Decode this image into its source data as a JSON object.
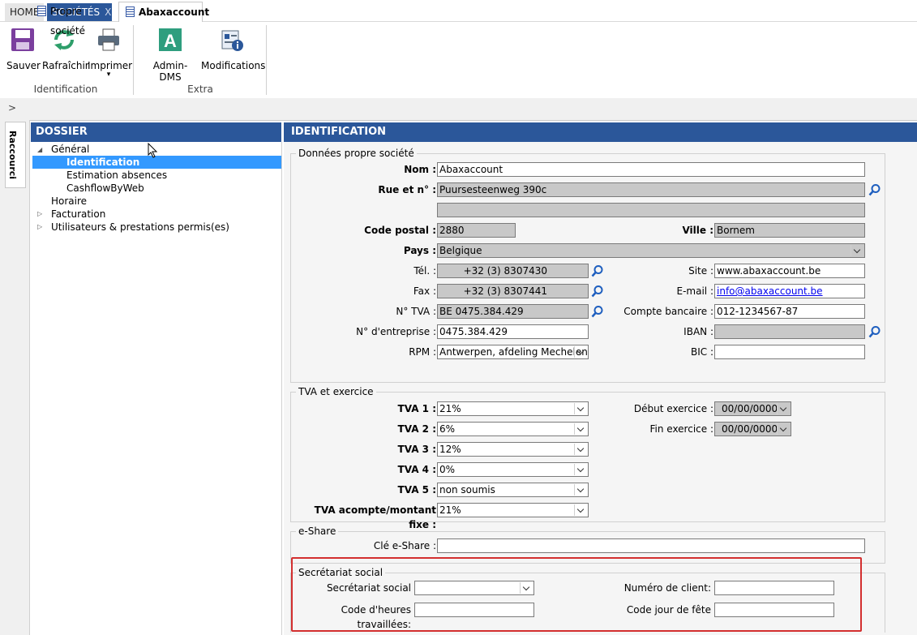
{
  "top_tabs": {
    "home": "HOME",
    "societes": "SOCIÉTÉS",
    "close": "X"
  },
  "ribbon": {
    "save": "Sauver",
    "refresh": "Rafraîchir",
    "print": "Imprimer",
    "print_arrow": "▾",
    "group_identification": "Identification",
    "admin_dms": "Admin-DMS",
    "modifications": "Modifications",
    "group_extra": "Extra"
  },
  "doc_tabs": {
    "chevron": ">",
    "propre": "Propre société",
    "abax": "Abaxaccount"
  },
  "side_tab": "Raccourci",
  "dossier": {
    "title": "DOSSIER",
    "items": [
      {
        "label": "Général",
        "arrow": "◢"
      },
      {
        "label": "Identification"
      },
      {
        "label": "Estimation absences"
      },
      {
        "label": "CashflowByWeb"
      },
      {
        "label": "Horaire"
      },
      {
        "label": "Facturation",
        "arrow": "▷"
      },
      {
        "label": "Utilisateurs & prestations permis(es)",
        "arrow": "▷"
      }
    ]
  },
  "identification": {
    "title": "IDENTIFICATION",
    "company": {
      "legend": "Données propre société",
      "nom_label": "Nom :",
      "nom": "Abaxaccount",
      "rue_label": "Rue et n° :",
      "rue": "Puursesteenweg 390c",
      "rue2": "",
      "cp_label": "Code postal :",
      "cp": "2880",
      "ville_label": "Ville :",
      "ville": "Bornem",
      "pays_label": "Pays :",
      "pays": "Belgique",
      "tel_label": "Tél. :",
      "tel": "+32 (3) 8307430",
      "fax_label": "Fax :",
      "fax": "+32 (3) 8307441",
      "tva_label": "N° TVA :",
      "tva": "BE 0475.384.429",
      "entreprise_label": "N° d'entreprise :",
      "entreprise": "0475.384.429",
      "rpm_label": "RPM :",
      "rpm": "Antwerpen, afdeling Mechelen",
      "site_label": "Site :",
      "site": "www.abaxaccount.be",
      "email_label": "E-mail :",
      "email": "info@abaxaccount.be",
      "compte_label": "Compte bancaire :",
      "compte": "012-1234567-87",
      "iban_label": "IBAN :",
      "iban": "",
      "bic_label": "BIC :",
      "bic": ""
    },
    "tva": {
      "legend": "TVA et exercice",
      "tva1_label": "TVA 1 :",
      "tva1": "21%",
      "tva2_label": "TVA 2 :",
      "tva2": "6%",
      "tva3_label": "TVA 3 :",
      "tva3": "12%",
      "tva4_label": "TVA 4 :",
      "tva4": "0%",
      "tva5_label": "TVA 5 :",
      "tva5": "non soumis",
      "acompte_label": "TVA acompte/montant fixe :",
      "acompte": "21%",
      "debut_label": "Début exercice :",
      "debut": "00/00/0000",
      "fin_label": "Fin exercice :",
      "fin": "00/00/0000"
    },
    "eshare": {
      "legend": "e-Share",
      "cle_label": "Clé e-Share :",
      "cle": ""
    },
    "social": {
      "legend": "Secrétariat social",
      "secr_label": "Secrétariat social",
      "secr": "",
      "heures_label": "Code d'heures travaillées:",
      "heures": "",
      "client_label": "Numéro de client:",
      "client": "",
      "fete_label": "Code jour de fête",
      "fete": ""
    }
  }
}
